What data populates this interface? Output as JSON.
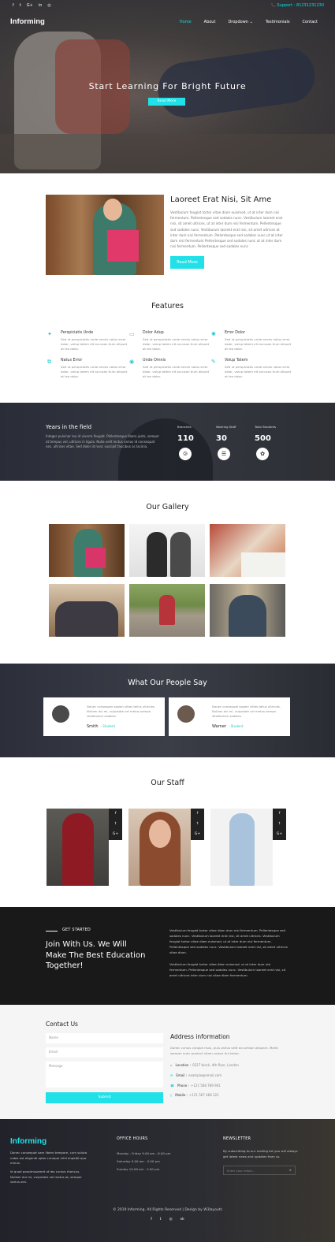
{
  "topbar": {
    "social": [
      "f",
      "t",
      "G+",
      "in",
      "◎"
    ],
    "phone": "📞 Support : 81231231230"
  },
  "brand": "Informing",
  "nav": {
    "items": [
      "Home",
      "About",
      "Dropdown ⌄",
      "Testimonials",
      "Contact"
    ]
  },
  "hero": {
    "title": "Start Learning For Bright Future",
    "button": "Read More"
  },
  "about": {
    "title": "Laoreet Erat Nisi, Sit Ame",
    "text": "Vestibulum feugiat tortor vitae diam euismod, ut at inter dum nisi fermentum. Pellentesque sed sodales nunc. Vestibulum laoreet erat nisi, sit amet ultrices, ut at inter dum nisi fermentum. Pellentesque sed sodales nunc. Vestibulum laoreet erat nisi, sit amet ultrices at inter dum nisi fermentum. Pellentesque sed sodales nunc ut at inter dum nisi fermentum Pellentesque sed sodales nunc ut at inter dum nisi fermentum. Pellentesque sed sodales nunc",
    "button": "Read More"
  },
  "features": {
    "title": "Features",
    "items": [
      {
        "icon": "✦",
        "title": "Perspiciatis Unde",
        "desc": "Sed ut perspiciatis unde omnis natus error dolor, volup tatem elt accusan tium aliquet at leo dolor."
      },
      {
        "icon": "▭",
        "title": "Dolor Adup",
        "desc": "Sed ut perspiciatis unde omnis natus error dolor, volup tatem elt accusan tium aliquet at leo dolor."
      },
      {
        "icon": "✺",
        "title": "Error Dolor",
        "desc": "Sed ut perspiciatis unde omnis natus error dolor, volup tatem elt accusan tium aliquet at leo dolor."
      },
      {
        "icon": "⧉",
        "title": "Natus Error",
        "desc": "Sed ut perspiciatis unde omnis natus error dolor, volup tatem elt accusan tium aliquet at leo dolor."
      },
      {
        "icon": "◉",
        "title": "Unde Omnis",
        "desc": "Sed ut perspiciatis unde omnis natus error dolor, volup tatem elt accusan tium aliquet at leo dolor."
      },
      {
        "icon": "✎",
        "title": "Volup Tatem",
        "desc": "Sed ut perspiciatis unde omnis natus error dolor, volup tatem elt accusan tium aliquet at leo dolor."
      }
    ]
  },
  "stats": {
    "title": "Years in the field",
    "text": "Integer pulvinar leo id viverra feugiat. Pellentesque libero justo, semper at tempus vel, ultrices in ligula. Nulla velit lectus varius id consequat nec, ultrices vitae. Sed dolor id nunc suscipit faucibus ac lacinia.",
    "items": [
      {
        "label": "Branches",
        "value": "110",
        "icon": "⧁"
      },
      {
        "label": "Working Staff",
        "value": "30",
        "icon": "☰"
      },
      {
        "label": "Total Students",
        "value": "500",
        "icon": "✿"
      }
    ]
  },
  "gallery": {
    "title": "Our Gallery"
  },
  "testimonials": {
    "title": "What Our People Say",
    "items": [
      {
        "quote": "Donec consequat sapien viltes tellus ultricies. Nullam dui mi, vulputate vel metus sempe. Vestibulum sodales.",
        "name": "Smith",
        "role": "- Student"
      },
      {
        "quote": "Donec consequat sapien viltes tellus ultricies. Nullam dui mi, vulputate vel metus sempe. Vestibulum sodales.",
        "name": "Warner",
        "role": "- Student"
      }
    ]
  },
  "staff": {
    "title": "Our Staff",
    "social": [
      "f",
      "t",
      "G+"
    ]
  },
  "join": {
    "tag": "GET STARTED",
    "title": "Join With Us. We Will Make The Best Education Together!",
    "text1": "Vestibulum feugiat tortor vitae diam dum nisi fermentum. Pellentesque sed sodales nunc. Vestibulum laoreet erat nisi, sit amet ultrices. Vestibulum feugiat tortor vitae diam euismod, ut at inter dum nisi fermentum. Pellentesque sed sodales nunc. Vestibulum laoreet erat nisi, sit amet ultrices vitae diam.",
    "text2": "Vestibulum feugiat tortor vitae diam euismod, ut at inter dum nisi fermentum. Pellentesque sed sodales nunc. Vestibulum laoreet erat nisi, sit amet ultrices inter dum nisi vitae diam fermentum."
  },
  "contact": {
    "title": "Contact Us",
    "name_placeholder": "Name",
    "email_placeholder": "Email",
    "message_placeholder": "Message",
    "submit": "Submit",
    "addr_title": "Address information",
    "addr_text": "Donec cursus congue risus, quis varius velit accumsan aliquam. Morbi semper nunc product ullam corper dui tortor.",
    "rows": [
      {
        "icon": "⌂",
        "label": "Location :",
        "value": "0227 block, 4th floor, London"
      },
      {
        "icon": "✉",
        "label": "Email :",
        "value": "example@email.com"
      },
      {
        "icon": "☎",
        "label": "Phone :",
        "value": "+121 568 789 901"
      },
      {
        "icon": "▯",
        "label": "Mobile :",
        "value": "+121 567 468 321"
      }
    ]
  },
  "footer": {
    "brand": "Informing",
    "text1": "Donec consequat sam libero tempore, cum soluta nobis est eligendi optio cumque nihil impedit quo minus.",
    "text2": "Id quod possimusamet ut leo cursus rhoncus. Nullam dui mi, vulputate vel metus at, semper varius orci.",
    "office_title": "OFFICE HOURS",
    "hours": [
      "Monday - Friday 9.00 am - 6.00 pm",
      "Saturday 9.00 am - 5.00 pm",
      "Sunday 10.00 am - 2.00 pm"
    ],
    "news_title": "NEWSLETTER",
    "news_text": "By subscribing to our mailing list you will always get latest news and updates from us.",
    "news_placeholder": "Enter your email...",
    "copyright": "© 2019 Informing. All Rights Reserved | Design by W3layouts",
    "social": [
      "f",
      "t",
      "◎",
      "vk"
    ]
  }
}
